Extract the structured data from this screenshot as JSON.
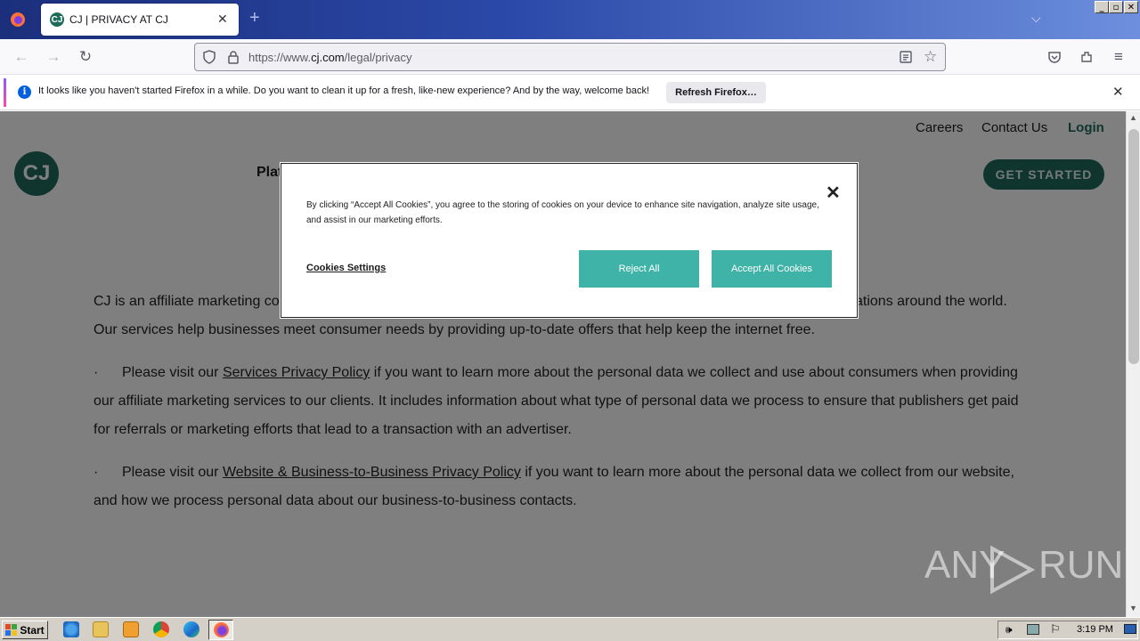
{
  "browser": {
    "tab_title": "CJ | PRIVACY AT CJ",
    "tab_favicon": "CJ",
    "new_tab_symbol": "+",
    "url_prefix": "https://www.",
    "url_domain": "cj.com",
    "url_path": "/legal/privacy",
    "window_buttons": [
      "_",
      "▫",
      "✕"
    ]
  },
  "notification": {
    "message": "It looks like you haven't started Firefox in a while. Do you want to clean it up for a fresh, like-new experience? And by the way, welcome back!",
    "button_label": "Refresh Firefox…"
  },
  "site": {
    "logo_text": "CJ",
    "top_links": [
      "Careers",
      "Contact Us",
      "Login"
    ],
    "get_started": "GET STARTED",
    "nav_partial": "Plat",
    "intro_line1_start": "CJ is an affiliate marketing co",
    "intro_line1_end": "ations around the world.",
    "intro_line2": "Our services help businesses meet consumer needs by providing up-to-date offers that help keep the internet free.",
    "bullet_marker": "·",
    "bullet1_pre": "Please visit our ",
    "bullet1_link": "Services Privacy Policy",
    "bullet1_post": " if you want to learn more about the personal data we collect and use about consumers when providing our affiliate marketing services to our clients. It includes information about what type of personal data we process to ensure that publishers get paid for referrals or marketing efforts that lead to a transaction with an advertiser.",
    "bullet2_pre": "Please visit our ",
    "bullet2_link": "Website & Business-to-Business Privacy Policy",
    "bullet2_post": " if you want to learn more about the personal data we collect from our website, and how we process personal data about our business-to-business contacts."
  },
  "cookie_modal": {
    "text": "By clicking “Accept All Cookies”, you agree to the storing of cookies on your device to enhance site navigation, analyze site usage, and assist in our marketing efforts.",
    "settings_label": "Cookies Settings",
    "reject_label": "Reject All",
    "accept_label": "Accept All Cookies",
    "close_symbol": "✕"
  },
  "watermark": {
    "text": "ANY",
    "text2": "RUN"
  },
  "taskbar": {
    "start_label": "Start",
    "clock": "3:19 PM"
  },
  "colors": {
    "brand": "#1e6b5c",
    "button": "#3fb3a8"
  }
}
